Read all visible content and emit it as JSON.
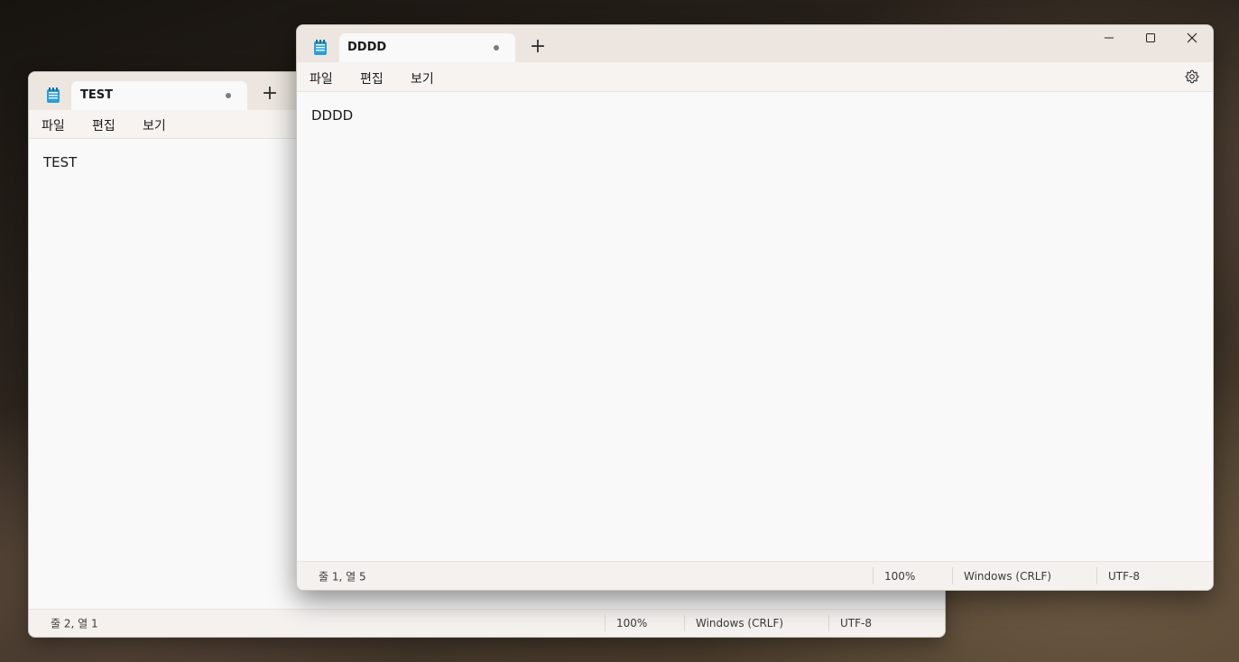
{
  "background_window": {
    "tab_title": "TEST",
    "menu": [
      "파일",
      "편집",
      "보기"
    ],
    "content": "TEST",
    "status": {
      "position": "줄 2, 열 1",
      "zoom": "100%",
      "line_ending": "Windows (CRLF)",
      "encoding": "UTF-8"
    }
  },
  "foreground_window": {
    "tab_title": "DDDD",
    "menu": [
      "파일",
      "편집",
      "보기"
    ],
    "content": "DDDD",
    "status": {
      "position": "줄 1, 열 5",
      "zoom": "100%",
      "line_ending": "Windows (CRLF)",
      "encoding": "UTF-8"
    }
  },
  "icons": {
    "app": "notepad-icon",
    "new_tab": "plus-icon",
    "unsaved": "dot-icon",
    "minimize": "minimize-icon",
    "maximize": "maximize-icon",
    "close": "close-icon",
    "settings": "gear-icon"
  },
  "colors": {
    "titlebar": "#ede6e0",
    "editor_bg": "#f9f9f9",
    "text": "#1b1b1b",
    "app_icon_accent": "#2a9fd6"
  }
}
